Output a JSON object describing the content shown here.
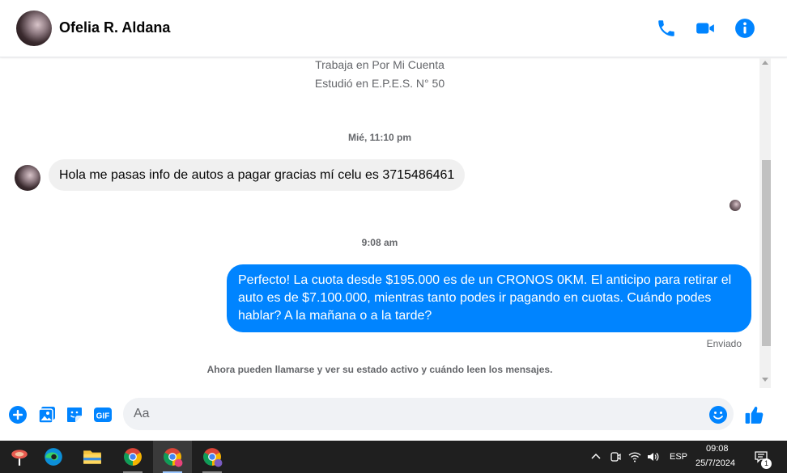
{
  "header": {
    "contact_name": "Ofelia R. Aldana",
    "icons": [
      "avatar",
      "phone-icon",
      "video-icon",
      "info-icon"
    ],
    "accent_color": "#0084ff"
  },
  "profile_info": {
    "work": "Trabaja en Por Mi Cuenta",
    "education": "Estudió en E.P.E.S. N° 50"
  },
  "messages": [
    {
      "timestamp": "Mié, 11:10 pm",
      "direction": "incoming",
      "text": "Hola me pasas info de autos a pagar gracias mí celu es 3715486461"
    },
    {
      "timestamp": "9:08 am",
      "direction": "outgoing",
      "text": "Perfecto! La cuota desde $195.000 es de un CRONOS 0KM. El anticipo para retirar el auto es de $7.100.000, mientras tanto podes ir pagando en cuotas. Cuándo podes hablar? A la mañana o a la tarde?",
      "status": "Enviado"
    }
  ],
  "notice": "Ahora pueden llamarse y ver su estado activo y cuándo leen los mensajes.",
  "composer": {
    "placeholder": "Aa",
    "icons": [
      "plus-icon",
      "photo-icon",
      "sticker-icon",
      "gif-icon",
      "emoji-icon",
      "thumbs-up-icon"
    ],
    "gif_label": "GIF"
  },
  "taskbar": {
    "apps": [
      "lutris-icon",
      "edge-icon",
      "file-explorer-icon",
      "chrome-icon",
      "chrome-profile-icon",
      "chrome-profile-2-icon"
    ],
    "language": "ESP",
    "time": "09:08",
    "date": "25/7/2024",
    "notification_count": "1"
  }
}
